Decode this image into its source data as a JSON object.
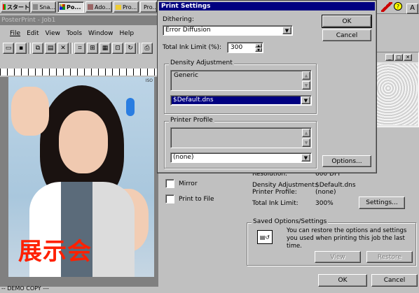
{
  "taskbar": {
    "start": "スタート",
    "items": [
      "Sna...",
      "Po...",
      "Ado...",
      "Pro...",
      "Pro...",
      ""
    ]
  },
  "app": {
    "title": "PosterPrint - Job1",
    "menu": [
      "File",
      "Edit",
      "View",
      "Tools",
      "Window",
      "Help"
    ],
    "watermark": "展示会",
    "demo_label": "-- DEMO COPY ---",
    "photo_badge": "ISO"
  },
  "dialog": {
    "title": "Print Settings",
    "dithering_label": "Dithering:",
    "dithering_value": "Error Diffusion",
    "ink_label": "Total Ink Limit (%):",
    "ink_value": "300",
    "density_group": "Density Adjustment",
    "density_list": [
      "Generic"
    ],
    "density_value": "$Default.dns",
    "profile_group": "Printer Profile",
    "profile_list": [],
    "profile_value": "(none)",
    "ok": "OK",
    "cancel": "Cancel",
    "options": "Options..."
  },
  "panel": {
    "mirror": "Mirror",
    "print_to_file": "Print to File",
    "info": [
      {
        "label": "Resolution:",
        "value": "600 DPI"
      },
      {
        "label": "Density Adjustment:",
        "value": "$Default.dns"
      },
      {
        "label": "Printer Profile:",
        "value": "(none)"
      },
      {
        "label": "Total Ink Limit:",
        "value": "300%"
      }
    ],
    "settings_btn": "Settings...",
    "saved_group": "Saved Options/Settings",
    "saved_text": "You can restore the options and settings you used when printing this job the last time.",
    "view_btn": "View",
    "restore_btn": "Restore",
    "ok": "OK",
    "cancel": "Cancel"
  },
  "colors": {
    "titlebar": "#000080",
    "watermark": "#ff2000",
    "highlight": "#000080"
  }
}
